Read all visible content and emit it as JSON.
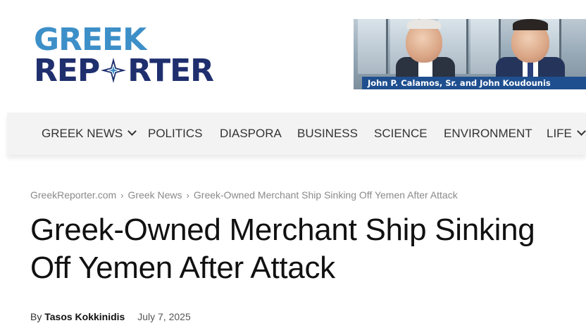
{
  "logo": {
    "line1": "GREEK",
    "line2_left": "REP",
    "line2_right": "RTER",
    "star_icon": "compass-star-icon",
    "colors": {
      "light_blue": "#3d8fc8",
      "navy": "#1f2f6e"
    }
  },
  "banner": {
    "caption": "John P. Calamos, Sr. and John Koudounis",
    "caption_bg": "#1f4f8f"
  },
  "nav": {
    "items": [
      {
        "label": "GREEK NEWS",
        "has_dropdown": true
      },
      {
        "label": "POLITICS"
      },
      {
        "label": "DIASPORA"
      },
      {
        "label": "BUSINESS"
      },
      {
        "label": "SCIENCE"
      },
      {
        "label": "ENVIRONMENT"
      },
      {
        "label": "LIFE",
        "has_dropdown": true
      }
    ]
  },
  "breadcrumb": {
    "items": [
      "GreekReporter.com",
      "Greek News",
      "Greek-Owned Merchant Ship Sinking Off Yemen After Attack"
    ],
    "separator": "›"
  },
  "article": {
    "title_line1": "Greek-Owned Merchant Ship Sinking",
    "title_line2": "Off Yemen After Attack",
    "by_label": "By",
    "author": "Tasos Kokkinidis",
    "date": "July 7, 2025"
  }
}
